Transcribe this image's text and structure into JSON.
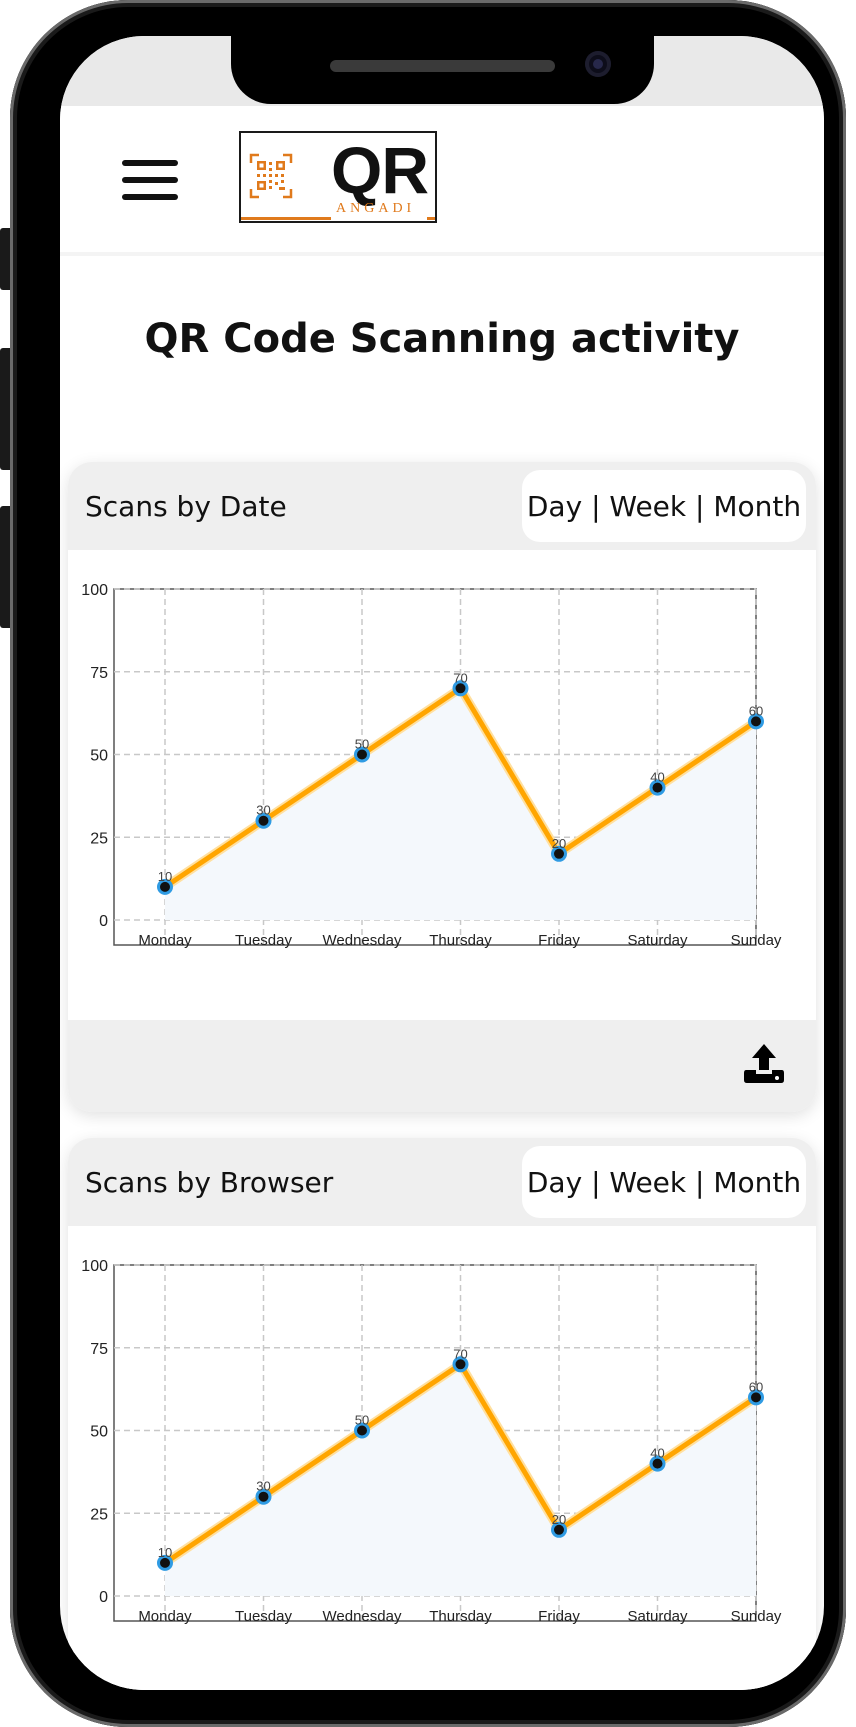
{
  "app": {
    "logo_text": "QR",
    "logo_sub": "ANGADI"
  },
  "page": {
    "title": "QR Code Scanning activity"
  },
  "cards": [
    {
      "title": "Scans by Date",
      "range_label": "Day | Week | Month",
      "export_icon": "upload-icon"
    },
    {
      "title": "Scans by Browser",
      "range_label": "Day | Week | Month"
    }
  ],
  "colors": {
    "line": "#ffa500",
    "point_fill": "#111111",
    "point_ring": "#2f9be3",
    "area_fill": "#f4f8fc",
    "logo_accent": "#e07a1c"
  },
  "chart_data": [
    {
      "type": "line",
      "categories": [
        "Monday",
        "Tuesday",
        "Wednesday",
        "Thursday",
        "Friday",
        "Saturday",
        "Sunday"
      ],
      "values": [
        10,
        30,
        50,
        70,
        20,
        40,
        60
      ],
      "y_ticks": [
        "0",
        "25",
        "50",
        "75",
        "100"
      ],
      "ylim": [
        0,
        100
      ],
      "grid": true,
      "data_labels": true
    },
    {
      "type": "line",
      "categories": [
        "Monday",
        "Tuesday",
        "Wednesday",
        "Thursday",
        "Friday",
        "Saturday",
        "Sunday"
      ],
      "values": [
        10,
        30,
        50,
        70,
        20,
        40,
        60
      ],
      "y_ticks": [
        "0",
        "25",
        "50",
        "75",
        "100"
      ],
      "ylim": [
        0,
        100
      ],
      "grid": true,
      "data_labels": true
    }
  ]
}
